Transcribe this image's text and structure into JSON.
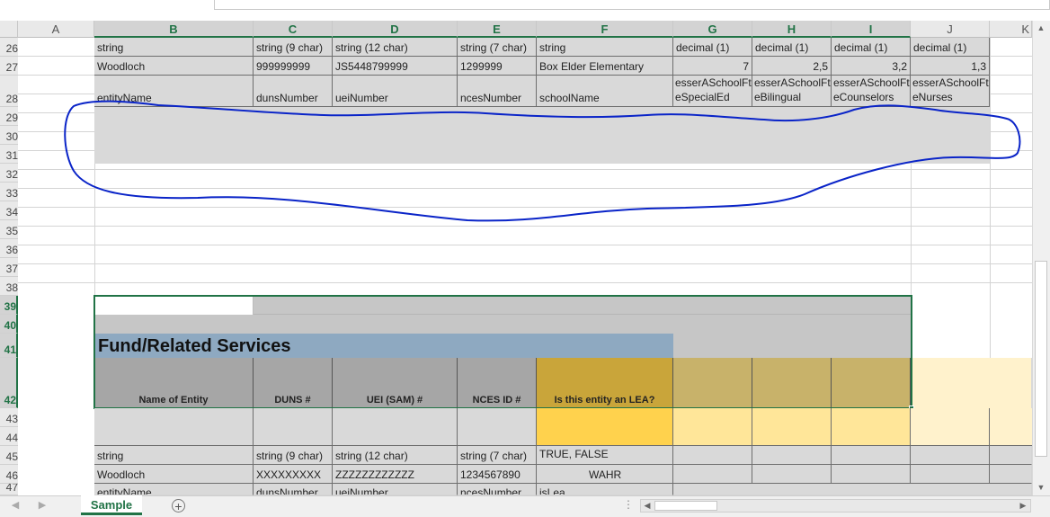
{
  "columns": [
    "A",
    "B",
    "C",
    "D",
    "E",
    "F",
    "G",
    "H",
    "I",
    "J",
    "K"
  ],
  "rows_top": [
    "26",
    "27",
    "28",
    "29",
    "30",
    "31",
    "32",
    "33",
    "34",
    "35",
    "36",
    "37",
    "38"
  ],
  "rows_bottom": [
    "39",
    "40",
    "41",
    "42",
    "43",
    "44",
    "45",
    "46",
    "47"
  ],
  "row26": [
    "string",
    "string (9 char)",
    "string (12 char)",
    "string (7 char)",
    "string",
    "decimal (1)",
    "decimal (1)",
    "decimal (1)",
    "decimal (1)"
  ],
  "row27": [
    "Woodloch",
    "999999999",
    "JS5448799999",
    "1299999",
    "Box Elder Elementary",
    "7",
    "2,5",
    "3,2",
    "1,3"
  ],
  "row28": [
    "entityName",
    "dunsNumber",
    "ueiNumber",
    "ncesNumber",
    "schoolName",
    "esserASchoolFteSpecialEd",
    "esserASchoolFteBilingual",
    "esserASchoolFteCounselors",
    "esserASchoolFteNurses"
  ],
  "row28_top": [
    "esserASchoolFt",
    "esserASchoolFt",
    "esserASchoolFt",
    "esserASchoolFt"
  ],
  "row28_bottom": [
    "eSpecialEd",
    "eBilingual",
    "eCounselors",
    "eNurses"
  ],
  "banner": "Fund/Related Services",
  "headers42": [
    "Name of Entity",
    "DUNS #",
    "UEI (SAM) #",
    "NCES ID #",
    "Is this entity an LEA?"
  ],
  "row45": [
    "string",
    "string (9 char)",
    "string (12 char)",
    "string (7 char)",
    "TRUE, FALSE"
  ],
  "row46": [
    "Woodloch",
    "XXXXXXXXX",
    "ZZZZZZZZZZZZ",
    "1234567890",
    "WAHR"
  ],
  "row47": [
    "entityName",
    "dunsNumber",
    "ueiNumber",
    "ncesNumber",
    "isLea"
  ],
  "sheet_tab": "Sample",
  "colors": {
    "accent": "#217346",
    "annotation": "#0a24c8",
    "banner": "#8ea9c1",
    "gold_dark": "#c9a53a",
    "gold_light": "#ffe699",
    "gold_pale": "#fff2cc"
  }
}
